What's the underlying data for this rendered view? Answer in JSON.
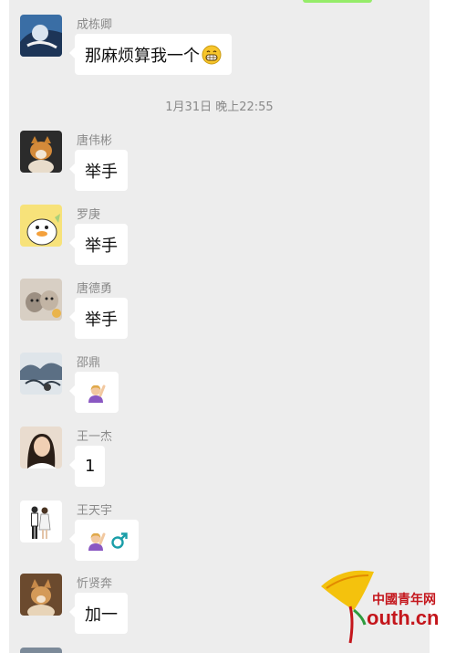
{
  "messages": [
    {
      "name": "成栋卿",
      "text": "那麻烦算我一个",
      "emoji": "grin-emoji"
    },
    {
      "name": "唐伟彬",
      "text": "举手"
    },
    {
      "name": "罗庚",
      "text": "举手"
    },
    {
      "name": "唐德勇",
      "text": "举手"
    },
    {
      "name": "邵鼎",
      "emoji": "raising-hand-woman-emoji"
    },
    {
      "name": "王一杰",
      "text": "1"
    },
    {
      "name": "王天宇",
      "emoji": "raising-hand-woman-male-sign-emoji"
    },
    {
      "name": "忻贤奔",
      "text": "加一"
    }
  ],
  "timestamp": "1月31日 晚上22:55",
  "watermark": {
    "cn": "中國青年网",
    "en": "outh.cn"
  },
  "colors": {
    "background": "#ededed",
    "bubble": "#ffffff",
    "watermark": "#c4161c"
  }
}
